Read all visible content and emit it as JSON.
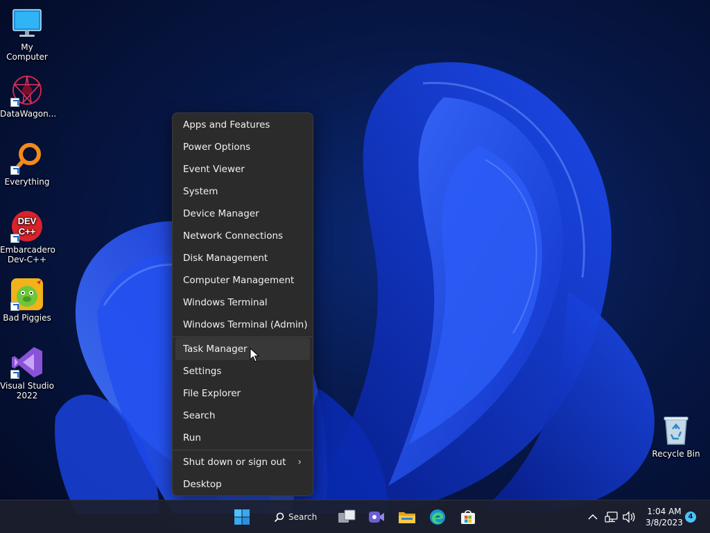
{
  "desktop": {
    "icons": [
      {
        "label": "My Computer"
      },
      {
        "label": "DataWagon..."
      },
      {
        "label": "Everything"
      },
      {
        "label": "Embarcadero Dev-C++"
      },
      {
        "label": "Bad Piggies"
      },
      {
        "label": "Visual Studio 2022"
      },
      {
        "label": "Recycle Bin"
      }
    ],
    "devcpp_badge": {
      "line1": "DEV",
      "line2": "C++"
    }
  },
  "context_menu": {
    "group1": [
      "Apps and Features",
      "Power Options",
      "Event Viewer",
      "System",
      "Device Manager",
      "Network Connections",
      "Disk Management",
      "Computer Management",
      "Windows Terminal",
      "Windows Terminal (Admin)"
    ],
    "group2": [
      "Task Manager",
      "Settings",
      "File Explorer",
      "Search",
      "Run"
    ],
    "group3": [
      "Shut down or sign out",
      "Desktop"
    ],
    "hovered_item": "Task Manager",
    "submenu_chevron": "›"
  },
  "taskbar": {
    "search_label": "Search",
    "clock_time": "1:04 AM",
    "clock_date": "3/8/2023",
    "notification_count": "4",
    "icons": [
      "windows-start-icon",
      "search-icon",
      "task-view-icon",
      "teams-chat-icon",
      "file-explorer-icon",
      "edge-browser-icon",
      "microsoft-store-icon"
    ],
    "tray_icons": [
      "chevron-up-icon",
      "network-icon",
      "volume-icon"
    ]
  },
  "colors": {
    "menu_bg": "#2b2b2b",
    "menu_hover": "#383838",
    "taskbar_bg": "#1c1f2c",
    "accent": "#4cc2ff",
    "wallpaper_blue": "#1f46e0"
  }
}
